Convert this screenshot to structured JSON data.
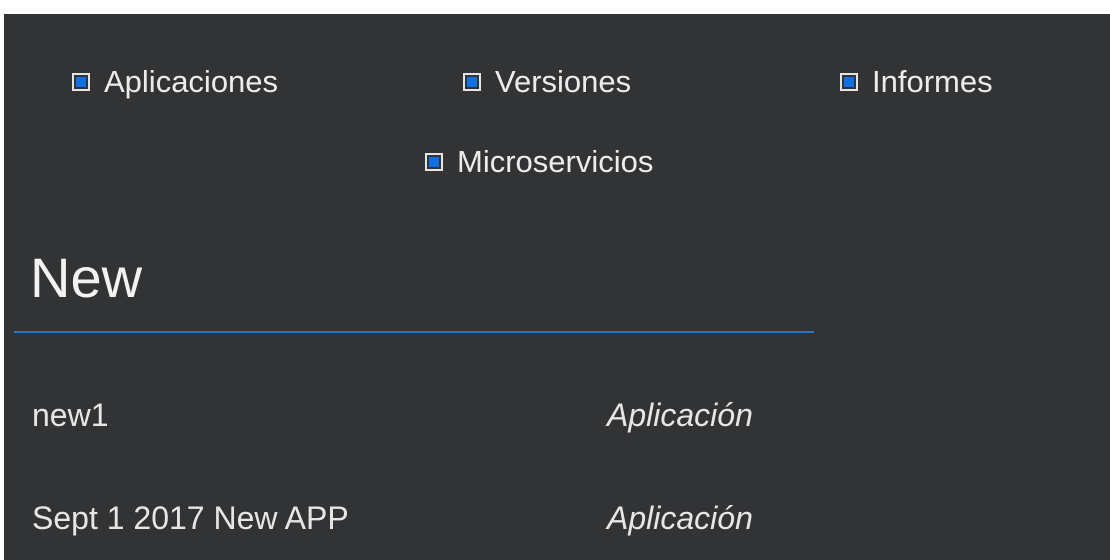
{
  "filters": [
    {
      "label": "Aplicaciones",
      "checked": true
    },
    {
      "label": "Versiones",
      "checked": true
    },
    {
      "label": "Informes",
      "checked": true
    },
    {
      "label": "Microservicios",
      "checked": true
    }
  ],
  "search": {
    "value": "New"
  },
  "results": [
    {
      "name": "new1",
      "type": "Aplicación"
    },
    {
      "name": "Sept 1 2017 New APP",
      "type": "Aplicación"
    }
  ],
  "colors": {
    "background": "#323335",
    "accent": "#0a72e6",
    "underline": "#2475c3"
  }
}
